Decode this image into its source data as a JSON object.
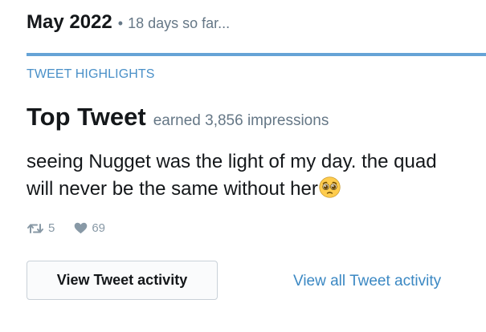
{
  "header": {
    "month": "May 2022",
    "separator": "•",
    "subtitle": "18 days so far..."
  },
  "highlights": {
    "section_label": "TWEET HIGHLIGHTS",
    "top_tweet_title": "Top Tweet",
    "impressions_text": "earned 3,856 impressions",
    "tweet_text": "seeing Nugget was the light of my day. the quad will never be the same without her",
    "emoji": "pleading-face-emoji",
    "retweets": "5",
    "likes": "69"
  },
  "actions": {
    "view_activity_button": "View Tweet activity",
    "view_all_link": "View all Tweet activity"
  },
  "colors": {
    "divider": "#66a3d6",
    "section_label": "#4a90c8",
    "link": "#3b88c3",
    "muted": "#657786",
    "stat": "#8899a6"
  }
}
